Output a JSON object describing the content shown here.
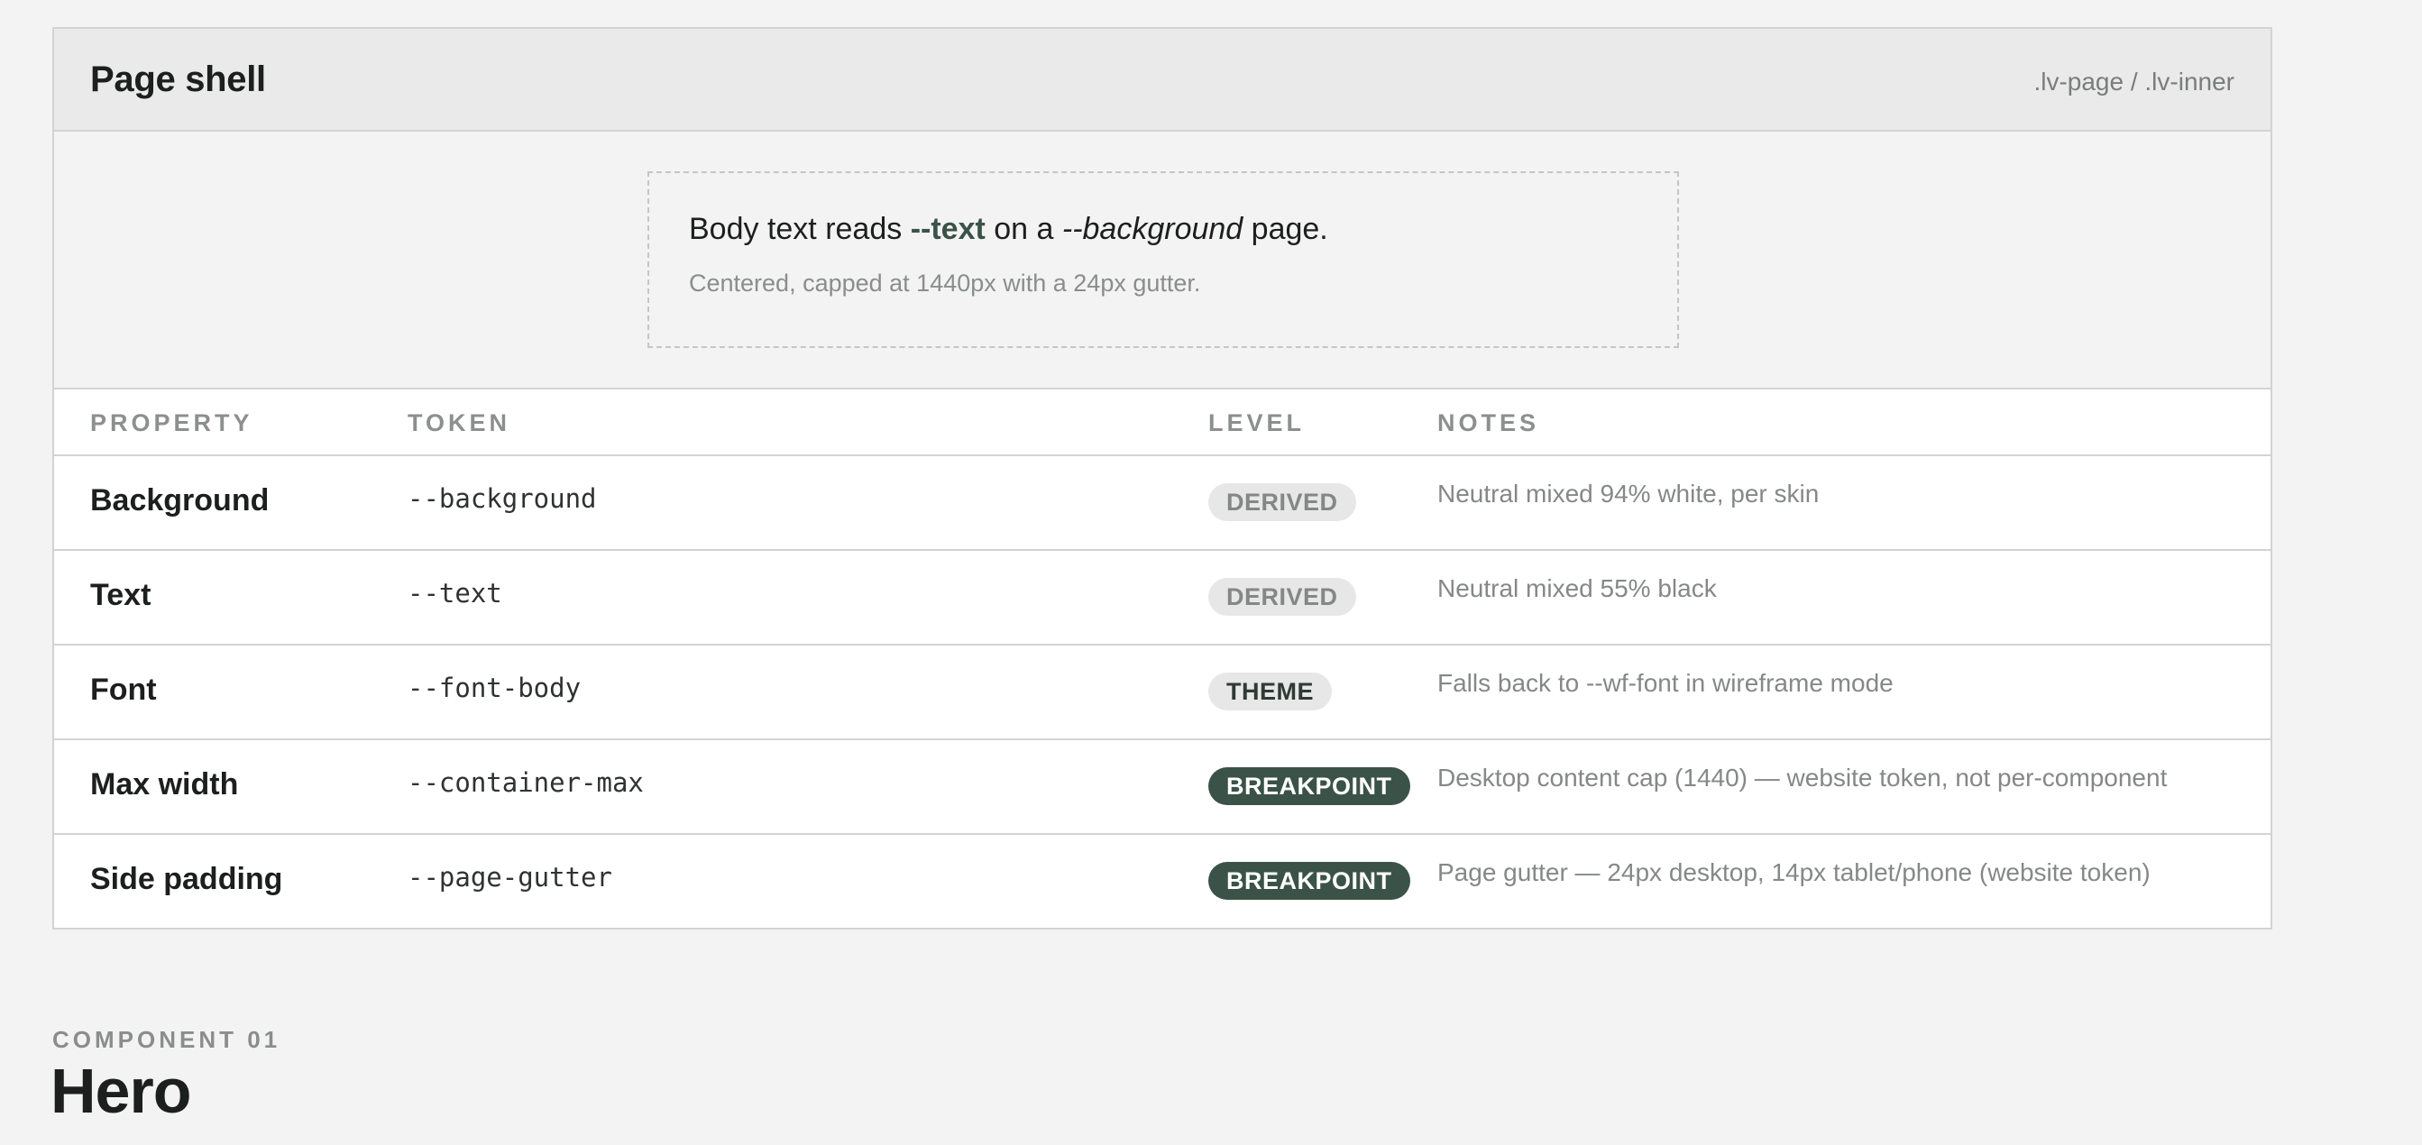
{
  "card": {
    "title": "Page shell",
    "selector": ".lv-page / .lv-inner"
  },
  "preview": {
    "line_prefix": "Body text reads ",
    "token_text": "--text",
    "line_middle": " on a ",
    "token_background": "--background",
    "line_suffix": " page.",
    "subtext": "Centered, capped at 1440px with a 24px gutter."
  },
  "table": {
    "headers": {
      "property": "PROPERTY",
      "token": "TOKEN",
      "level": "LEVEL",
      "notes": "NOTES"
    },
    "rows": [
      {
        "property": "Background",
        "token": "--background",
        "level": "DERIVED",
        "notes": "Neutral mixed 94% white, per skin"
      },
      {
        "property": "Text",
        "token": "--text",
        "level": "DERIVED",
        "notes": "Neutral mixed 55% black"
      },
      {
        "property": "Font",
        "token": "--font-body",
        "level": "THEME",
        "notes": "Falls back to --wf-font in wireframe mode"
      },
      {
        "property": "Max width",
        "token": "--container-max",
        "level": "BREAKPOINT",
        "notes": "Desktop content cap (1440) — website token, not per-component"
      },
      {
        "property": "Side padding",
        "token": "--page-gutter",
        "level": "BREAKPOINT",
        "notes": "Page gutter — 24px desktop, 14px tablet/phone (website token)"
      }
    ]
  },
  "section": {
    "eyebrow": "COMPONENT 01",
    "title": "Hero"
  },
  "colors": {
    "page_background": "#f3f3f3",
    "accent": "#3b5249",
    "badge_neutral": "#e6e7e6"
  }
}
